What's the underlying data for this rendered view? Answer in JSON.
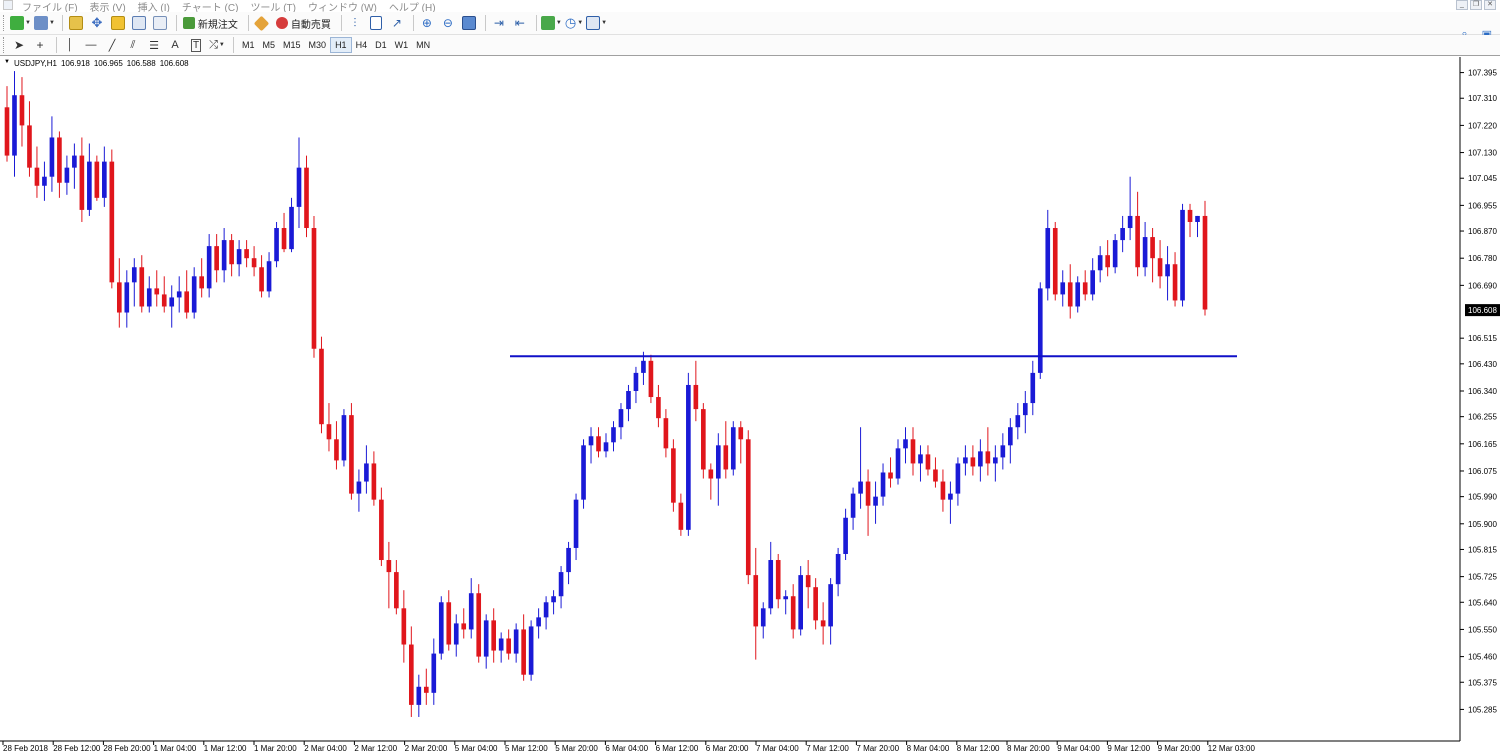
{
  "menu": {
    "items": [
      "ファイル (F)",
      "表示 (V)",
      "挿入 (I)",
      "チャート (C)",
      "ツール (T)",
      "ウィンドウ (W)",
      "ヘルプ (H)"
    ]
  },
  "toolbar": {
    "new_order_label": "新規注文",
    "autotrade_label": "自動売買",
    "timeframes": [
      "M1",
      "M5",
      "M15",
      "M30",
      "H1",
      "H4",
      "D1",
      "W1",
      "MN"
    ],
    "active_timeframe": "H1"
  },
  "chart": {
    "symbol_header": "USDJPY,H1",
    "ohlc": [
      "106.918",
      "106.965",
      "106.588",
      "106.608"
    ],
    "current_price_label": "106.608",
    "colors": {
      "bull": "#1a1ad6",
      "bear": "#e0161c",
      "line": "#1010c8",
      "doji": "#19b919",
      "price_tag": "#000000"
    }
  },
  "chart_data": {
    "type": "candlestick",
    "symbol": "USDJPY",
    "timeframe": "H1",
    "y_ticks": [
      "107.395",
      "107.310",
      "107.220",
      "107.130",
      "107.045",
      "106.955",
      "106.870",
      "106.780",
      "106.690",
      "106.515",
      "106.430",
      "106.340",
      "106.255",
      "106.165",
      "106.075",
      "105.990",
      "105.900",
      "105.815",
      "105.725",
      "105.640",
      "105.550",
      "105.460",
      "105.375",
      "105.285"
    ],
    "ylim": [
      105.24,
      107.44
    ],
    "x_ticks": [
      "28 Feb 2018",
      "28 Feb 12:00",
      "28 Feb 20:00",
      "1 Mar 04:00",
      "1 Mar 12:00",
      "1 Mar 20:00",
      "2 Mar 04:00",
      "2 Mar 12:00",
      "2 Mar 20:00",
      "5 Mar 04:00",
      "5 Mar 12:00",
      "5 Mar 20:00",
      "6 Mar 04:00",
      "6 Mar 12:00",
      "6 Mar 20:00",
      "7 Mar 04:00",
      "7 Mar 12:00",
      "7 Mar 20:00",
      "8 Mar 04:00",
      "8 Mar 12:00",
      "8 Mar 20:00",
      "9 Mar 04:00",
      "9 Mar 12:00",
      "9 Mar 20:00",
      "12 Mar 03:00"
    ],
    "horizontal_line": 106.455,
    "last_price": 106.608,
    "candles": [
      [
        107.28,
        107.35,
        107.1,
        107.12
      ],
      [
        107.12,
        107.4,
        107.05,
        107.32
      ],
      [
        107.32,
        107.38,
        107.15,
        107.22
      ],
      [
        107.22,
        107.3,
        107.05,
        107.08
      ],
      [
        107.08,
        107.15,
        106.98,
        107.02
      ],
      [
        107.02,
        107.1,
        106.97,
        107.05
      ],
      [
        107.05,
        107.25,
        107.0,
        107.18
      ],
      [
        107.18,
        107.2,
        106.98,
        107.03
      ],
      [
        107.03,
        107.12,
        106.99,
        107.08
      ],
      [
        107.08,
        107.16,
        107.01,
        107.12
      ],
      [
        107.12,
        107.18,
        106.9,
        106.94
      ],
      [
        106.94,
        107.16,
        106.92,
        107.1
      ],
      [
        107.1,
        107.12,
        106.97,
        106.98
      ],
      [
        106.98,
        107.15,
        106.95,
        107.1
      ],
      [
        107.1,
        107.14,
        106.68,
        106.7
      ],
      [
        106.7,
        106.78,
        106.55,
        106.6
      ],
      [
        106.6,
        106.74,
        106.55,
        106.7
      ],
      [
        106.7,
        106.78,
        106.62,
        106.75
      ],
      [
        106.75,
        106.79,
        106.6,
        106.62
      ],
      [
        106.62,
        106.72,
        106.6,
        106.68
      ],
      [
        106.68,
        106.74,
        106.62,
        106.66
      ],
      [
        106.66,
        106.72,
        106.6,
        106.62
      ],
      [
        106.62,
        106.69,
        106.55,
        106.65
      ],
      [
        106.65,
        106.72,
        106.6,
        106.67
      ],
      [
        106.67,
        106.74,
        106.58,
        106.6
      ],
      [
        106.6,
        106.75,
        106.58,
        106.72
      ],
      [
        106.72,
        106.78,
        106.65,
        106.68
      ],
      [
        106.68,
        106.86,
        106.65,
        106.82
      ],
      [
        106.82,
        106.86,
        106.7,
        106.74
      ],
      [
        106.74,
        106.88,
        106.7,
        106.84
      ],
      [
        106.84,
        106.86,
        106.72,
        106.76
      ],
      [
        106.76,
        106.84,
        106.72,
        106.81
      ],
      [
        106.81,
        106.84,
        106.75,
        106.78
      ],
      [
        106.78,
        106.82,
        106.72,
        106.75
      ],
      [
        106.75,
        106.79,
        106.65,
        106.67
      ],
      [
        106.67,
        106.8,
        106.65,
        106.77
      ],
      [
        106.77,
        106.9,
        106.75,
        106.88
      ],
      [
        106.88,
        106.93,
        106.8,
        106.81
      ],
      [
        106.81,
        106.98,
        106.8,
        106.95
      ],
      [
        106.95,
        107.18,
        106.88,
        107.08
      ],
      [
        107.08,
        107.12,
        106.85,
        106.88
      ],
      [
        106.88,
        106.92,
        106.45,
        106.48
      ],
      [
        106.48,
        106.52,
        106.2,
        106.23
      ],
      [
        106.23,
        106.3,
        106.14,
        106.18
      ],
      [
        106.18,
        106.24,
        106.08,
        106.11
      ],
      [
        106.11,
        106.28,
        106.09,
        106.26
      ],
      [
        106.26,
        106.3,
        105.98,
        106.0
      ],
      [
        106.0,
        106.08,
        105.94,
        106.04
      ],
      [
        106.04,
        106.16,
        106.0,
        106.1
      ],
      [
        106.1,
        106.14,
        105.96,
        105.98
      ],
      [
        105.98,
        106.02,
        105.76,
        105.78
      ],
      [
        105.78,
        105.84,
        105.62,
        105.74
      ],
      [
        105.74,
        105.78,
        105.6,
        105.62
      ],
      [
        105.62,
        105.68,
        105.44,
        105.5
      ],
      [
        105.5,
        105.56,
        105.26,
        105.3
      ],
      [
        105.3,
        105.4,
        105.26,
        105.36
      ],
      [
        105.36,
        105.42,
        105.3,
        105.34
      ],
      [
        105.34,
        105.52,
        105.3,
        105.47
      ],
      [
        105.47,
        105.66,
        105.45,
        105.64
      ],
      [
        105.64,
        105.68,
        105.48,
        105.5
      ],
      [
        105.5,
        105.6,
        105.46,
        105.57
      ],
      [
        105.57,
        105.62,
        105.52,
        105.55
      ],
      [
        105.55,
        105.72,
        105.52,
        105.67
      ],
      [
        105.67,
        105.7,
        105.44,
        105.46
      ],
      [
        105.46,
        105.6,
        105.42,
        105.58
      ],
      [
        105.58,
        105.62,
        105.44,
        105.48
      ],
      [
        105.48,
        105.54,
        105.44,
        105.52
      ],
      [
        105.52,
        105.55,
        105.45,
        105.47
      ],
      [
        105.47,
        105.57,
        105.44,
        105.55
      ],
      [
        105.55,
        105.6,
        105.38,
        105.4
      ],
      [
        105.4,
        105.58,
        105.38,
        105.56
      ],
      [
        105.56,
        105.62,
        105.52,
        105.59
      ],
      [
        105.59,
        105.66,
        105.55,
        105.64
      ],
      [
        105.64,
        105.68,
        105.6,
        105.66
      ],
      [
        105.66,
        105.76,
        105.62,
        105.74
      ],
      [
        105.74,
        105.84,
        105.7,
        105.82
      ],
      [
        105.82,
        106.0,
        105.78,
        105.98
      ],
      [
        105.98,
        106.18,
        105.95,
        106.16
      ],
      [
        106.16,
        106.22,
        106.1,
        106.19
      ],
      [
        106.19,
        106.22,
        106.12,
        106.14
      ],
      [
        106.14,
        106.2,
        106.12,
        106.17
      ],
      [
        106.17,
        106.24,
        106.14,
        106.22
      ],
      [
        106.22,
        106.3,
        106.18,
        106.28
      ],
      [
        106.28,
        106.36,
        106.24,
        106.34
      ],
      [
        106.34,
        106.42,
        106.3,
        106.4
      ],
      [
        106.4,
        106.47,
        106.36,
        106.44
      ],
      [
        106.44,
        106.46,
        106.3,
        106.32
      ],
      [
        106.32,
        106.36,
        106.22,
        106.25
      ],
      [
        106.25,
        106.28,
        106.12,
        106.15
      ],
      [
        106.15,
        106.18,
        105.94,
        105.97
      ],
      [
        105.97,
        106.0,
        105.86,
        105.88
      ],
      [
        105.88,
        106.4,
        105.86,
        106.36
      ],
      [
        106.36,
        106.44,
        106.24,
        106.28
      ],
      [
        106.28,
        106.3,
        106.05,
        106.08
      ],
      [
        106.08,
        106.1,
        105.98,
        106.05
      ],
      [
        106.05,
        106.2,
        105.96,
        106.16
      ],
      [
        106.16,
        106.24,
        106.05,
        106.08
      ],
      [
        106.08,
        106.24,
        106.06,
        106.22
      ],
      [
        106.22,
        106.24,
        106.1,
        106.18
      ],
      [
        106.18,
        106.21,
        105.7,
        105.73
      ],
      [
        105.73,
        105.82,
        105.45,
        105.56
      ],
      [
        105.56,
        105.64,
        105.52,
        105.62
      ],
      [
        105.62,
        105.84,
        105.6,
        105.78
      ],
      [
        105.78,
        105.8,
        105.62,
        105.65
      ],
      [
        105.65,
        105.68,
        105.6,
        105.66
      ],
      [
        105.66,
        105.7,
        105.52,
        105.55
      ],
      [
        105.55,
        105.76,
        105.53,
        105.73
      ],
      [
        105.73,
        105.78,
        105.62,
        105.69
      ],
      [
        105.69,
        105.72,
        105.55,
        105.58
      ],
      [
        105.58,
        105.64,
        105.5,
        105.56
      ],
      [
        105.56,
        105.72,
        105.5,
        105.7
      ],
      [
        105.7,
        105.82,
        105.66,
        105.8
      ],
      [
        105.8,
        105.95,
        105.78,
        105.92
      ],
      [
        105.92,
        106.02,
        105.88,
        106.0
      ],
      [
        106.0,
        106.22,
        105.95,
        106.04
      ],
      [
        106.04,
        106.08,
        105.86,
        105.96
      ],
      [
        105.96,
        106.04,
        105.9,
        105.99
      ],
      [
        105.99,
        106.1,
        105.96,
        106.07
      ],
      [
        106.07,
        106.12,
        106.02,
        106.05
      ],
      [
        106.05,
        106.18,
        106.03,
        106.15
      ],
      [
        106.15,
        106.22,
        106.1,
        106.18
      ],
      [
        106.18,
        106.22,
        106.06,
        106.1
      ],
      [
        106.1,
        106.16,
        106.04,
        106.13
      ],
      [
        106.13,
        106.16,
        106.06,
        106.08
      ],
      [
        106.08,
        106.12,
        106.02,
        106.04
      ],
      [
        106.04,
        106.08,
        105.94,
        105.98
      ],
      [
        105.98,
        106.04,
        105.9,
        106.0
      ],
      [
        106.0,
        106.12,
        105.96,
        106.1
      ],
      [
        106.1,
        106.16,
        106.06,
        106.12
      ],
      [
        106.12,
        106.16,
        106.06,
        106.09
      ],
      [
        106.09,
        106.18,
        106.04,
        106.14
      ],
      [
        106.14,
        106.22,
        106.06,
        106.1
      ],
      [
        106.1,
        106.16,
        106.04,
        106.12
      ],
      [
        106.12,
        106.2,
        106.08,
        106.16
      ],
      [
        106.16,
        106.25,
        106.1,
        106.22
      ],
      [
        106.22,
        106.3,
        106.18,
        106.26
      ],
      [
        106.26,
        106.34,
        106.2,
        106.3
      ],
      [
        106.3,
        106.44,
        106.26,
        106.4
      ],
      [
        106.4,
        106.7,
        106.38,
        106.68
      ],
      [
        106.68,
        106.94,
        106.64,
        106.88
      ],
      [
        106.88,
        106.9,
        106.64,
        106.66
      ],
      [
        106.66,
        106.74,
        106.62,
        106.7
      ],
      [
        106.7,
        106.76,
        106.58,
        106.62
      ],
      [
        106.62,
        106.72,
        106.6,
        106.7
      ],
      [
        106.7,
        106.74,
        106.64,
        106.66
      ],
      [
        106.66,
        106.78,
        106.64,
        106.74
      ],
      [
        106.74,
        106.82,
        106.7,
        106.79
      ],
      [
        106.79,
        106.84,
        106.72,
        106.75
      ],
      [
        106.75,
        106.86,
        106.73,
        106.84
      ],
      [
        106.84,
        106.92,
        106.8,
        106.88
      ],
      [
        106.88,
        107.05,
        106.84,
        106.92
      ],
      [
        106.92,
        107.0,
        106.72,
        106.75
      ],
      [
        106.75,
        106.9,
        106.72,
        106.85
      ],
      [
        106.85,
        106.88,
        106.7,
        106.78
      ],
      [
        106.78,
        106.84,
        106.68,
        106.72
      ],
      [
        106.72,
        106.82,
        106.64,
        106.76
      ],
      [
        106.76,
        106.8,
        106.62,
        106.64
      ],
      [
        106.64,
        106.96,
        106.62,
        106.94
      ],
      [
        106.94,
        106.96,
        106.85,
        106.9
      ],
      [
        106.9,
        106.92,
        106.85,
        106.92
      ],
      [
        106.92,
        106.97,
        106.59,
        106.61
      ]
    ]
  }
}
